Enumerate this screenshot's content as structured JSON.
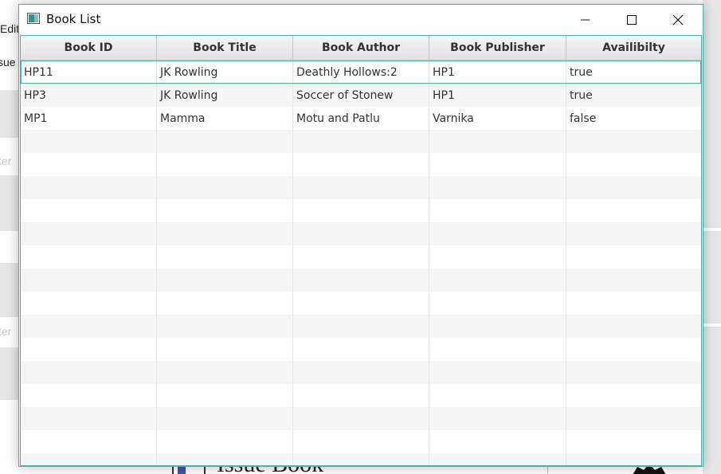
{
  "background_app": {
    "menu_edit": "Edit",
    "tab_issue_partial": "sue",
    "placeholder_partial_1": "ter",
    "placeholder_partial_2": "ter",
    "bottom_title": "Issue Book"
  },
  "window": {
    "title": "Book List",
    "icon": "java-app-icon",
    "controls": {
      "minimize": "minimize-icon",
      "maximize": "maximize-icon",
      "close": "close-icon"
    }
  },
  "table": {
    "columns": [
      "Book ID",
      "Book Title",
      "Book Author",
      "Book Publisher",
      "Availibilty"
    ],
    "rows": [
      [
        "HP11",
        "JK Rowling",
        "Deathly Hollows:2",
        "HP1",
        "true"
      ],
      [
        "HP3",
        "JK Rowling",
        "Soccer of Stonew",
        "HP1",
        "true"
      ],
      [
        "MP1",
        "Mamma",
        "Motu and Patlu",
        "Varnika",
        "false"
      ]
    ],
    "selected_row": 0,
    "empty_row_count": 15
  },
  "colors": {
    "accent": "#4ab3b0",
    "header_bg": "#e8e8e8",
    "odd_row_bg": "#f5f5f5"
  }
}
